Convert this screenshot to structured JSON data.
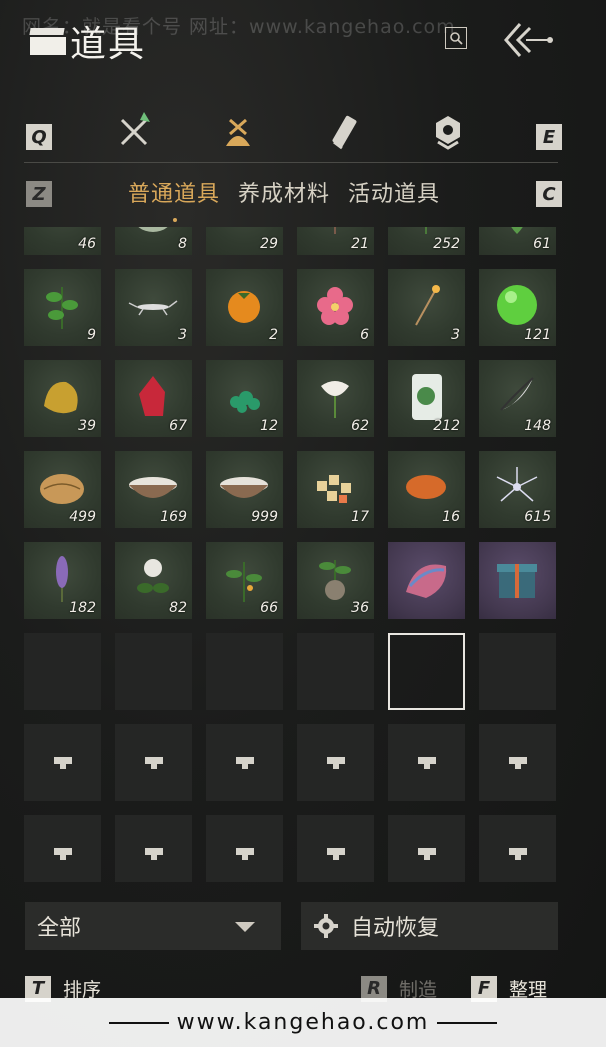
{
  "watermark_top": "网名：就是看个号   网址：www.kangehao.com",
  "header": {
    "title": "道具"
  },
  "keys": {
    "prev_category": "Q",
    "next_category": "E",
    "prev_sub": "Z",
    "next_sub": "C",
    "sort": "T",
    "craft": "R",
    "organize": "F"
  },
  "category_tabs": [
    "weapons-icon",
    "bundle-icon",
    "scroll-icon",
    "badge-icon"
  ],
  "sub_tabs": [
    "普通道具",
    "养成材料",
    "活动道具"
  ],
  "items": [
    {
      "name": "root",
      "count": "46"
    },
    {
      "name": "melon",
      "count": "8"
    },
    {
      "name": "sacks",
      "count": "29"
    },
    {
      "name": "branch",
      "count": "21"
    },
    {
      "name": "herb",
      "count": "252"
    },
    {
      "name": "leaf",
      "count": "61"
    },
    {
      "name": "mint",
      "count": "9"
    },
    {
      "name": "scorpion",
      "count": "3"
    },
    {
      "name": "persimmon",
      "count": "2"
    },
    {
      "name": "pink-flower",
      "count": "6"
    },
    {
      "name": "incense",
      "count": "3"
    },
    {
      "name": "jade-orb",
      "count": "121"
    },
    {
      "name": "gold-ore",
      "count": "39"
    },
    {
      "name": "red-crystal",
      "count": "67"
    },
    {
      "name": "green-gems",
      "count": "12"
    },
    {
      "name": "white-flower",
      "count": "62"
    },
    {
      "name": "jade-plant",
      "count": "212"
    },
    {
      "name": "feather",
      "count": "148"
    },
    {
      "name": "shell",
      "count": "499"
    },
    {
      "name": "milk-bowl",
      "count": "169"
    },
    {
      "name": "rice-bowl",
      "count": "999"
    },
    {
      "name": "sweets",
      "count": "17"
    },
    {
      "name": "orange-stone",
      "count": "16"
    },
    {
      "name": "silver-flower",
      "count": "615"
    },
    {
      "name": "lavender",
      "count": "182"
    },
    {
      "name": "white-bloom",
      "count": "82"
    },
    {
      "name": "berry-plant",
      "count": "66"
    },
    {
      "name": "root-plant",
      "count": "36"
    },
    {
      "name": "silk-bundle",
      "count": ""
    },
    {
      "name": "gift-box",
      "count": ""
    }
  ],
  "filter": {
    "value": "全部"
  },
  "auto_restore": {
    "label": "自动恢复"
  },
  "actions": {
    "sort": "排序",
    "craft": "制造",
    "organize": "整理"
  },
  "watermark_bottom": "www.kangehao.com",
  "colors": {
    "accent": "#d9a85a",
    "cell": "#303a2e",
    "rare": "#43384f"
  }
}
